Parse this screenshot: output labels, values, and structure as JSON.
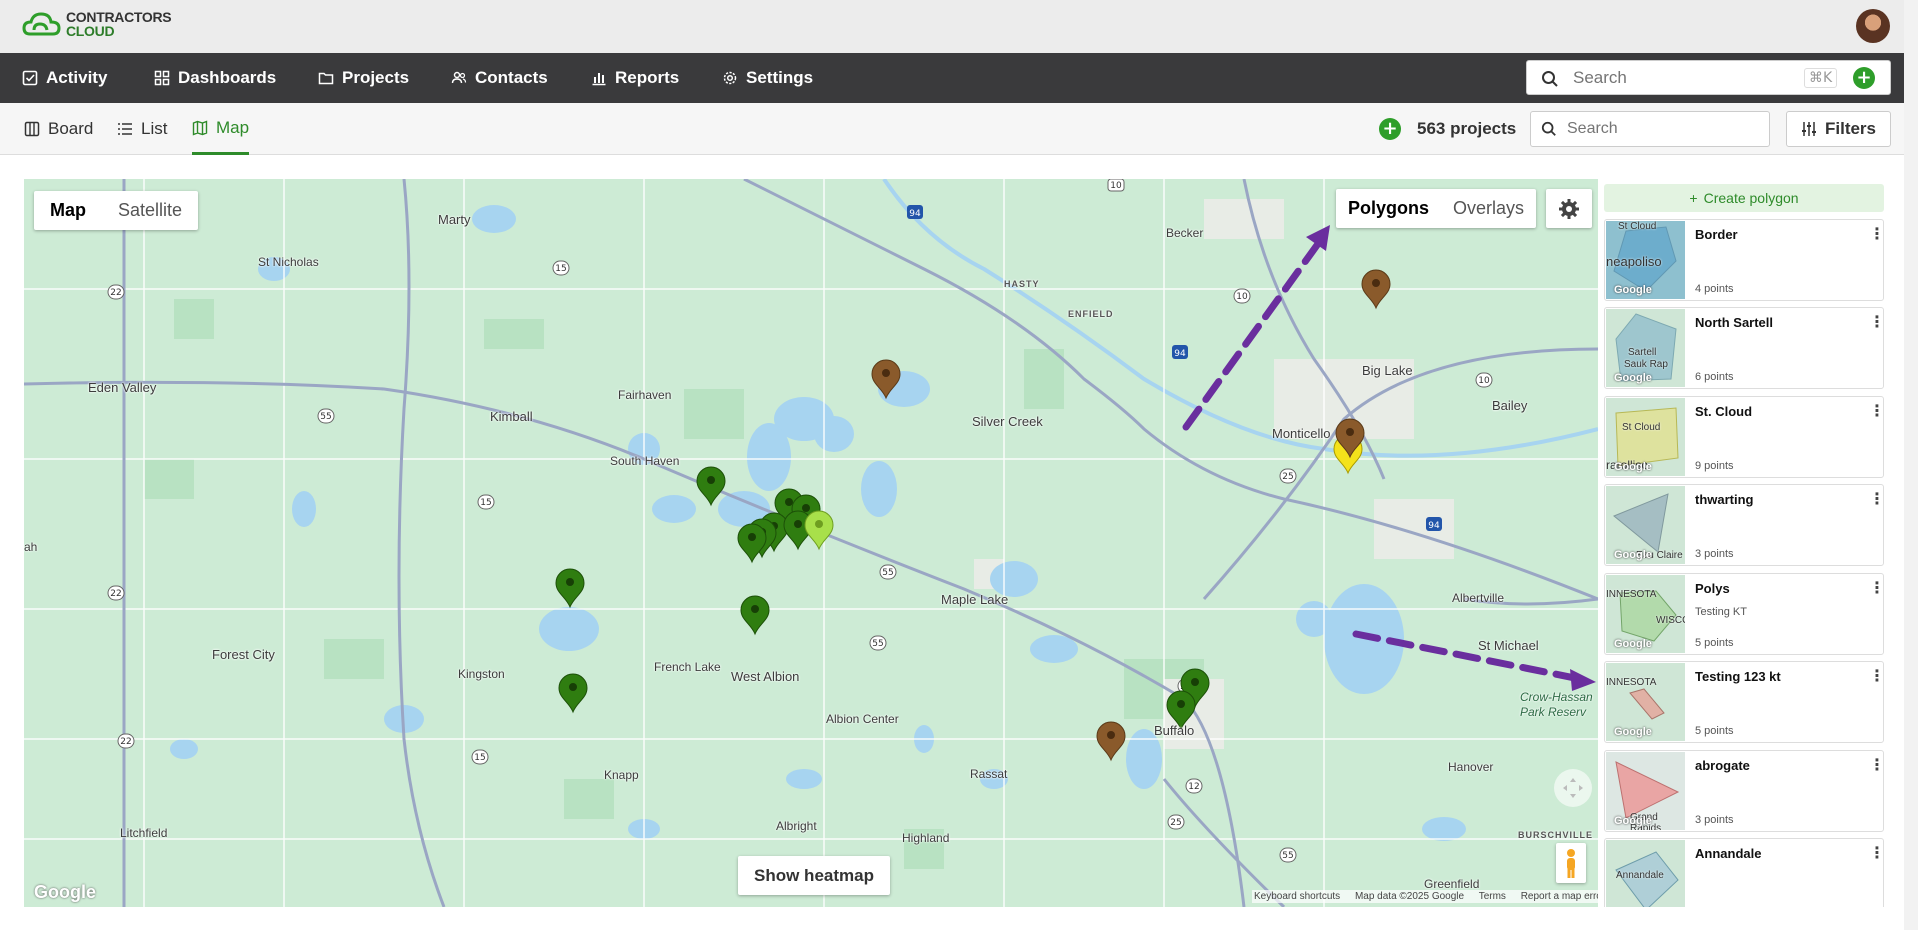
{
  "brand": {
    "line1": "CONTRACTORS",
    "line2": "CLOUD"
  },
  "nav": {
    "items": [
      {
        "label": "Activity",
        "icon": "checkbox-icon"
      },
      {
        "label": "Dashboards",
        "icon": "grid-icon"
      },
      {
        "label": "Projects",
        "icon": "folder-icon"
      },
      {
        "label": "Contacts",
        "icon": "people-icon"
      },
      {
        "label": "Reports",
        "icon": "bar-chart-icon"
      },
      {
        "label": "Settings",
        "icon": "gear-icon"
      }
    ],
    "search_placeholder": "Search",
    "shortcut": "⌘K"
  },
  "views": {
    "tabs": [
      {
        "label": "Board",
        "icon": "board-icon",
        "active": false
      },
      {
        "label": "List",
        "icon": "list-icon",
        "active": false
      },
      {
        "label": "Map",
        "icon": "map-icon",
        "active": true
      }
    ],
    "project_count": "563 projects",
    "search_placeholder": "Search",
    "filters_label": "Filters"
  },
  "map": {
    "type_buttons": [
      "Map",
      "Satellite"
    ],
    "active_type": "Map",
    "layer_tabs": [
      "Polygons",
      "Overlays"
    ],
    "active_layer": "Polygons",
    "heatmap_label": "Show heatmap",
    "google": "Google",
    "attribution": [
      "Keyboard shortcuts",
      "Map data ©2025 Google",
      "Terms",
      "Report a map error"
    ],
    "places": [
      "Marty",
      "St Nicholas",
      "Eden Valley",
      "Kimball",
      "Fairhaven",
      "South Haven",
      "Silver Creek",
      "Becker",
      "Big Lake",
      "Bailey",
      "Monticello",
      "Maple Lake",
      "Albertville",
      "St Michael",
      "Forest City",
      "Kingston",
      "French Lake",
      "West Albion",
      "Albion Center",
      "Rassat",
      "Buffalo",
      "Hanover",
      "Crow-Hassan",
      "Park Reserv",
      "Knapp",
      "Albright",
      "Highland",
      "Litchfield",
      "Greenfield",
      "ah",
      "HASTY",
      "ENFIELD",
      "BURSCHVILLE"
    ],
    "road_shields": [
      "10",
      "94",
      "15",
      "22",
      "55",
      "25",
      "94",
      "10",
      "10",
      "94",
      "25",
      "55",
      "15",
      "22",
      "22",
      "15",
      "12",
      "25",
      "55",
      "55"
    ],
    "colors": {
      "pin_green": "#2f7d10",
      "pin_brown": "#8a5a2b",
      "pin_lime": "#a8e04a",
      "pin_yellow": "#f4e21b",
      "arrow": "#6a2e9e",
      "water": "#a7d4f0",
      "land": "#cdebd5"
    }
  },
  "polygons": {
    "create_label": "Create polygon",
    "items": [
      {
        "name": "Border",
        "sub": "",
        "points": "4 points",
        "thumb_labels": [
          "St Cloud",
          "neapoliso"
        ],
        "fill": "#3d93c8"
      },
      {
        "name": "North Sartell",
        "sub": "",
        "points": "6 points",
        "thumb_labels": [
          "Sartell",
          "Sauk Rap"
        ],
        "fill": "#6fa8c8"
      },
      {
        "name": "St. Cloud",
        "sub": "",
        "points": "9 points",
        "thumb_labels": [
          "St Cloud",
          "rarolliso"
        ],
        "fill": "#e8e07a"
      },
      {
        "name": "thwarting",
        "sub": "",
        "points": "3 points",
        "thumb_labels": [
          "Eau Claire"
        ],
        "fill": "#8aa4b8"
      },
      {
        "name": "Polys",
        "sub": "Testing KT",
        "points": "5 points",
        "thumb_labels": [
          "INNESOTA",
          "WISCO"
        ],
        "fill": "#a6d69a"
      },
      {
        "name": "Testing 123 kt",
        "sub": "",
        "points": "5 points",
        "thumb_labels": [
          "INNESOTA"
        ],
        "fill": "#e6a49a"
      },
      {
        "name": "abrogate",
        "sub": "",
        "points": "3 points",
        "thumb_labels": [
          "Grand Rapids"
        ],
        "fill": "#ef8a8a"
      },
      {
        "name": "Annandale",
        "sub": "",
        "points": "",
        "thumb_labels": [
          "Annandale"
        ],
        "fill": "#9ac0d8"
      }
    ]
  }
}
